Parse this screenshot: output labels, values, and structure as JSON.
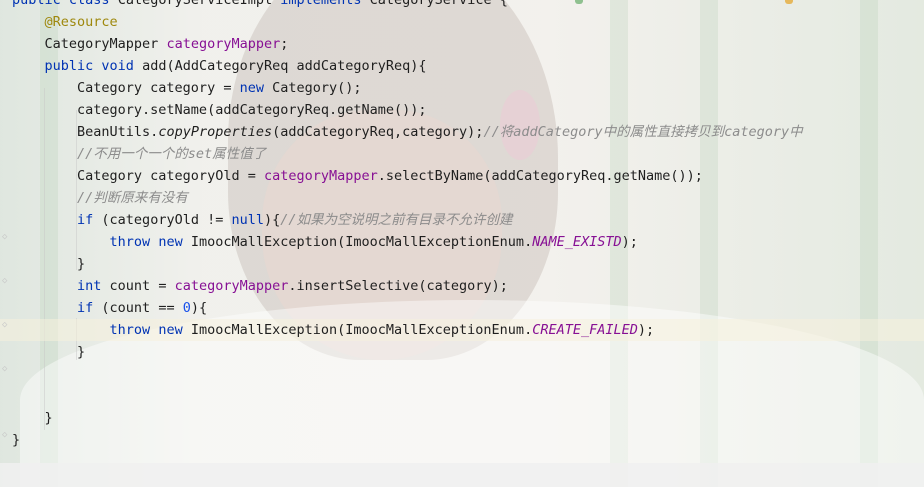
{
  "editor": {
    "language": "java",
    "lines": [
      {
        "tokens": [
          [
            "kw",
            "public "
          ],
          [
            "kw",
            "class "
          ],
          [
            "plain",
            "CategoryServiceImpl "
          ],
          [
            "kw",
            "implements "
          ],
          [
            "plain",
            "CategoryService {"
          ]
        ]
      },
      {
        "tokens": [
          [
            "plain",
            "    "
          ],
          [
            "ann",
            "@Resource"
          ]
        ]
      },
      {
        "tokens": [
          [
            "plain",
            "    CategoryMapper "
          ],
          [
            "fld",
            "categoryMapper"
          ],
          [
            "plain",
            ";"
          ]
        ]
      },
      {
        "tokens": [
          [
            "plain",
            "    "
          ],
          [
            "kw",
            "public void "
          ],
          [
            "plain",
            "add(AddCategoryReq addCategoryReq){"
          ]
        ]
      },
      {
        "tokens": [
          [
            "plain",
            "        Category category = "
          ],
          [
            "kw",
            "new "
          ],
          [
            "plain",
            "Category();"
          ]
        ]
      },
      {
        "tokens": [
          [
            "plain",
            "        category.setName(addCategoryReq.getName());"
          ]
        ]
      },
      {
        "tokens": [
          [
            "plain",
            "        BeanUtils."
          ],
          [
            "stat",
            "copyProperties"
          ],
          [
            "plain",
            "(addCategoryReq,category);"
          ],
          [
            "cmt",
            "//将addCategory中的属性直接拷贝到category中"
          ]
        ]
      },
      {
        "tokens": [
          [
            "plain",
            "        "
          ],
          [
            "cmt",
            "//不用一个一个的set属性值了"
          ]
        ]
      },
      {
        "tokens": [
          [
            "plain",
            "        Category categoryOld = "
          ],
          [
            "fld",
            "categoryMapper"
          ],
          [
            "plain",
            ".selectByName(addCategoryReq.getName());"
          ]
        ]
      },
      {
        "tokens": [
          [
            "plain",
            "        "
          ],
          [
            "cmt",
            "//判断原来有没有"
          ]
        ]
      },
      {
        "tokens": [
          [
            "plain",
            "        "
          ],
          [
            "kw",
            "if "
          ],
          [
            "plain",
            "(categoryOld != "
          ],
          [
            "kw",
            "null"
          ],
          [
            "plain",
            "){"
          ],
          [
            "cmt",
            "//如果为空说明之前有目录不允许创建"
          ]
        ]
      },
      {
        "tokens": [
          [
            "plain",
            "            "
          ],
          [
            "kw",
            "throw new "
          ],
          [
            "plain",
            "ImoocMallException(ImoocMallExceptionEnum."
          ],
          [
            "cnst",
            "NAME_EXISTD"
          ],
          [
            "plain",
            ");"
          ]
        ]
      },
      {
        "tokens": [
          [
            "plain",
            "        }"
          ]
        ]
      },
      {
        "tokens": [
          [
            "plain",
            "        "
          ],
          [
            "kw",
            "int "
          ],
          [
            "plain",
            "count = "
          ],
          [
            "fld",
            "categoryMapper"
          ],
          [
            "plain",
            ".insertSelective(category);"
          ]
        ]
      },
      {
        "tokens": [
          [
            "plain",
            "        "
          ],
          [
            "kw",
            "if "
          ],
          [
            "plain",
            "(count == "
          ],
          [
            "num",
            "0"
          ],
          [
            "plain",
            "){"
          ]
        ]
      },
      {
        "tokens": [
          [
            "plain",
            "            "
          ],
          [
            "kw",
            "throw new "
          ],
          [
            "plain",
            "ImoocMallException(ImoocMallExceptionEnum."
          ],
          [
            "cnst",
            "CREATE_FAILED"
          ],
          [
            "plain",
            ");"
          ]
        ]
      },
      {
        "tokens": [
          [
            "plain",
            "        }"
          ]
        ]
      },
      {
        "tokens": []
      },
      {
        "tokens": []
      },
      {
        "tokens": [
          [
            "plain",
            "    }"
          ]
        ]
      },
      {
        "tokens": [
          [
            "plain",
            "}"
          ]
        ]
      }
    ],
    "current_line_index": 15,
    "colors": {
      "keyword": "#0033b3",
      "annotation": "#9e880d",
      "field": "#871094",
      "number": "#1750eb",
      "comment": "#8c8c8c",
      "text": "#1f1f1f"
    }
  },
  "top_indicators": [
    {
      "color": "#8fc08f"
    },
    {
      "color": "#e6b85c"
    }
  ]
}
